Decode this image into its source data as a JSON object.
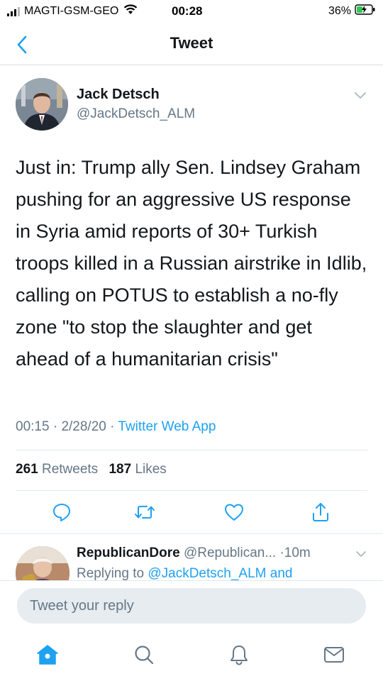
{
  "status_bar": {
    "carrier": "MAGTI-GSM-GEO",
    "time": "00:28",
    "battery": "36%"
  },
  "nav": {
    "title": "Tweet"
  },
  "tweet": {
    "author_name": "Jack Detsch",
    "author_handle": "@JackDetsch_ALM",
    "text": "Just in: Trump ally Sen. Lindsey Graham pushing for an aggressive US response in Syria amid reports of 30+ Turkish troops killed in a Russian airstrike in Idlib, calling on POTUS to establish a no-fly zone \"to stop the slaughter and get ahead of a humanitarian crisis\"",
    "time": "00:15",
    "date": "2/28/20",
    "source": "Twitter Web App",
    "retweets_count": "261",
    "retweets_label": "Retweets",
    "likes_count": "187",
    "likes_label": "Likes"
  },
  "reply_preview": {
    "name": "RepublicanDore",
    "handle": "@Republican...",
    "age": "10m",
    "replying_prefix": "Replying to",
    "replying_mention": "@JackDetsch_ALM",
    "replying_suffix": "and"
  },
  "composer": {
    "placeholder": "Tweet your reply"
  },
  "colors": {
    "accent": "#1da1f2",
    "secondary_text": "#657786",
    "primary_text": "#14171a",
    "divider": "#e1e8ed"
  },
  "icons": {
    "back": "chevron-left-icon",
    "more": "chevron-down-icon",
    "reply": "speech-bubble-icon",
    "retweet": "retweet-icon",
    "like": "heart-icon",
    "share": "share-icon",
    "home": "home-icon",
    "search": "search-icon",
    "notifications": "bell-icon",
    "messages": "envelope-icon"
  }
}
